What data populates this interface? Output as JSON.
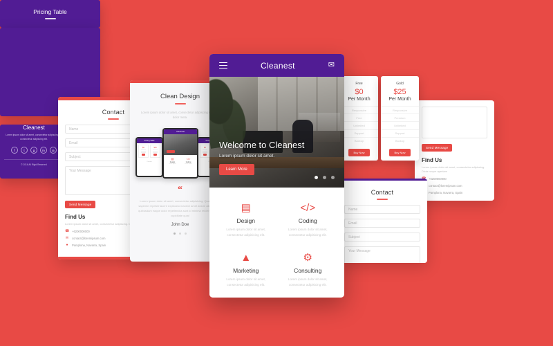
{
  "brand": {
    "name": "Cleanest",
    "primary": "#511c94",
    "accent": "#e84a45",
    "background": "#e84a45"
  },
  "main_app": {
    "header": {
      "title": "Cleanest",
      "menu_icon": "hamburger-icon",
      "mail_icon": "envelope-icon"
    },
    "hero": {
      "heading": "Welcome to Cleanest",
      "subheading": "Lorem ipsum dolor sit amet.",
      "cta": "Learn More",
      "slider_dots": 3
    },
    "services": [
      {
        "icon": "laptop-icon",
        "glyph": "ὋB",
        "name": "Design",
        "desc": "Lorem ipsum dolor sit amet, consectetur adipisicing elit."
      },
      {
        "icon": "code-icon",
        "glyph": "</>",
        "name": "Coding",
        "desc": "Lorem ipsum dolor sit amet, consectetur adipisicing elit."
      },
      {
        "icon": "bar-chart-icon",
        "glyph": "ὌA",
        "name": "Marketing",
        "desc": "Lorem ipsum dolor sit amet, consectetur adipisicing elit."
      },
      {
        "icon": "gears-icon",
        "glyph": "⚙",
        "name": "Consulting",
        "desc": "Lorem ipsum dolor sit amet, consectetur adipisicing elit."
      }
    ]
  },
  "contact_panel": {
    "title": "Contact",
    "fields": [
      {
        "name": "name-field",
        "placeholder": "Name"
      },
      {
        "name": "email-field",
        "placeholder": "Email"
      },
      {
        "name": "subject-field",
        "placeholder": "Subject"
      },
      {
        "name": "message-field",
        "placeholder": "Your Message"
      }
    ],
    "submit": "Send Message",
    "find_us": {
      "title": "Find Us",
      "desc": "Lorem ipsum dolor sit amet, consectetur adipiscing. Dicta neque aperiam",
      "phone": "+6200000000",
      "email": "contact@loremipsum.com",
      "address": "Pamplona, Navarra, Spain"
    }
  },
  "clean_design": {
    "title": "Clean Design",
    "desc": "Lorem ipsum dolor sit amet, consectetur adipiscing sit meta dolor meta.",
    "testimonial": {
      "quote_mark": "“",
      "text": "Lorem ipsum dolor sit amet, consectetur adipisicing. Quas earum, sapiente repellat facere explicabo maxime amet dolore aliquam velit quibusdam eaque dolor repellendus sunt id minima reiciendis neque cupiditate quia!",
      "author": "John Doe"
    },
    "phone_mockups": [
      {
        "label": "Pricing Table"
      },
      {
        "label": "Cleanest"
      },
      {
        "label": "Pricing Table"
      }
    ]
  },
  "pricing_bar": {
    "title": "Pricing Table"
  },
  "pricing": {
    "plans": [
      {
        "label": "Free",
        "price": "$0",
        "period": "Per Month",
        "features": [
          "Responsive",
          "Free",
          "Unlimited",
          "Support",
          "Backup"
        ],
        "cta": "Buy Now"
      },
      {
        "label": "Gold",
        "price": "$25",
        "period": "Per Month",
        "features": [
          "Responsive",
          "Premium",
          "Unlimited",
          "Support",
          "Backup"
        ],
        "cta": "Buy Now"
      }
    ]
  },
  "footer": {
    "brand": "Cleanest",
    "desc": "Lorem ipsum dolor sit amet, consectetur adipiscing elit consectetur adipiscing elit.",
    "socials": [
      {
        "name": "facebook-icon",
        "glyph": "f"
      },
      {
        "name": "twitter-icon",
        "glyph": "t"
      },
      {
        "name": "google-plus-icon",
        "glyph": "g"
      },
      {
        "name": "linkedin-icon",
        "glyph": "in"
      },
      {
        "name": "instagram-icon",
        "glyph": "◎"
      }
    ],
    "copyright": "© 2016 All Right Reserved"
  }
}
